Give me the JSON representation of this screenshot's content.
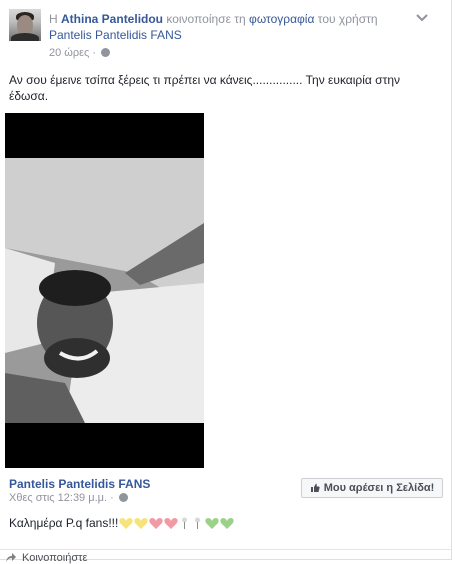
{
  "header": {
    "prefix": "Η",
    "author": "Athina Pantelidou",
    "action_pre": "κοινοποίησε τη",
    "photo_link": "φωτογραφία",
    "action_post": "του χρήστη",
    "page": "Pantelis Pantelidis FANS",
    "time": "20 ώρες"
  },
  "post": {
    "text": "Αν σου έμεινε τσίπα ξέρεις τι πρέπει να κάνεις............... Την ευκαιρία στην έδωσα."
  },
  "shared": {
    "page_name": "Pantelis Pantelidis FANS",
    "time": "Χθες στις 12:39 μ.μ.",
    "like_page_label": "Μου αρέσει η Σελίδα!",
    "text": "Καλημέρα Ρ.q fans!!!"
  },
  "footer": {
    "label": "Κοινοποιήστε"
  },
  "colors": {
    "link": "#365899",
    "meta": "#90949c",
    "heart_yellow": "#f6e37a",
    "heart_pink": "#f29aa3",
    "heart_green": "#9bd28a"
  },
  "icons": [
    "globe-icon",
    "chevron-down-icon",
    "like-thumb-icon",
    "share-icon",
    "heart-icon",
    "flower-icon"
  ]
}
